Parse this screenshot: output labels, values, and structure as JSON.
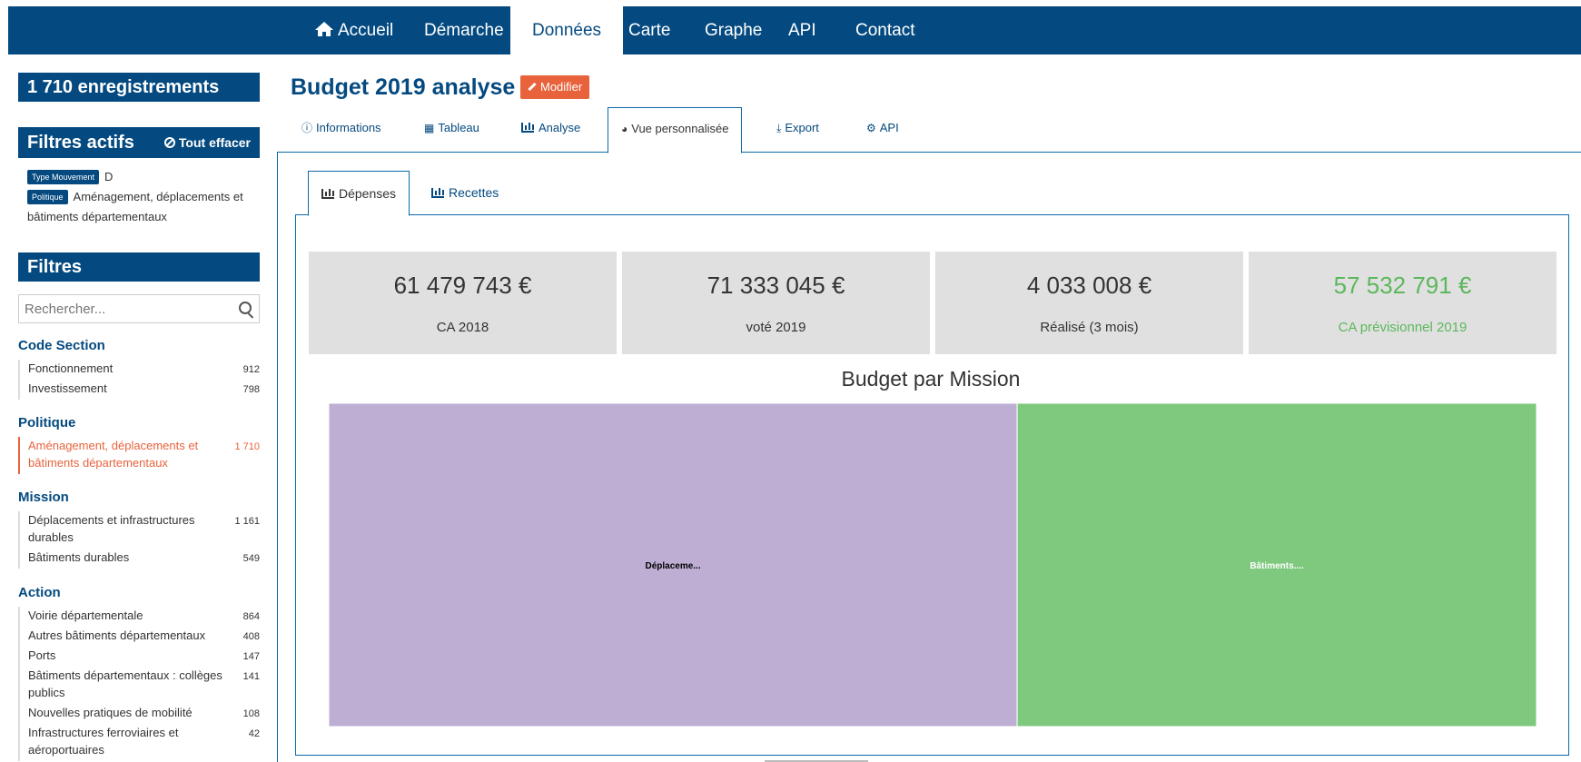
{
  "nav": {
    "items": [
      {
        "label": "Accueil",
        "icon": "home-icon"
      },
      {
        "label": "Démarche"
      },
      {
        "label": "Données",
        "active": true
      },
      {
        "label": "Carte"
      },
      {
        "label": "Graphe"
      },
      {
        "label": "API"
      },
      {
        "label": "Contact"
      }
    ]
  },
  "sidebar": {
    "count_label": "1 710 enregistrements",
    "active_filters_title": "Filtres actifs",
    "clear_all_label": "Tout effacer",
    "active_filters": [
      {
        "tag": "Type Mouvement",
        "value": "D"
      },
      {
        "tag": "Politique",
        "value": "Aménagement, déplacements et bâtiments départementaux"
      }
    ],
    "filters_title": "Filtres",
    "search_placeholder": "Rechercher...",
    "facets": [
      {
        "title": "Code Section",
        "items": [
          {
            "label": "Fonctionnement",
            "count": "912"
          },
          {
            "label": "Investissement",
            "count": "798"
          }
        ]
      },
      {
        "title": "Politique",
        "items": [
          {
            "label": "Aménagement, déplacements et bâtiments départementaux",
            "count": "1 710",
            "selected": true
          }
        ]
      },
      {
        "title": "Mission",
        "items": [
          {
            "label": "Déplacements et infrastructures durables",
            "count": "1 161"
          },
          {
            "label": "Bâtiments durables",
            "count": "549"
          }
        ]
      },
      {
        "title": "Action",
        "items": [
          {
            "label": "Voirie départementale",
            "count": "864"
          },
          {
            "label": "Autres bâtiments départementaux",
            "count": "408"
          },
          {
            "label": "Ports",
            "count": "147"
          },
          {
            "label": "Bâtiments départementaux : collèges publics",
            "count": "141"
          },
          {
            "label": "Nouvelles pratiques de mobilité",
            "count": "108"
          },
          {
            "label": "Infrastructures ferroviaires et aéroportuaires",
            "count": "42"
          }
        ]
      }
    ]
  },
  "main": {
    "title": "Budget 2019 analyse",
    "modify_label": "Modifier",
    "tabs": [
      {
        "label": "Informations",
        "icon": "info-icon"
      },
      {
        "label": "Tableau",
        "icon": "table-icon"
      },
      {
        "label": "Analyse",
        "icon": "bar-chart-icon"
      },
      {
        "label": "Vue personnalisée",
        "icon": "dashboard-icon",
        "active": true
      },
      {
        "label": "Export",
        "icon": "download-icon"
      },
      {
        "label": "API",
        "icon": "cogs-icon"
      }
    ],
    "sub_tabs": [
      {
        "label": "Dépenses",
        "active": true
      },
      {
        "label": "Recettes"
      }
    ],
    "stats": [
      {
        "value": "61 479 743 €",
        "label": "CA 2018"
      },
      {
        "value": "71 333 045 €",
        "label": "voté 2019"
      },
      {
        "value": "4 033 008 €",
        "label": "Réalisé (3 mois)"
      },
      {
        "value": "57 532 791 €",
        "label": "CA prévisionnel 2019",
        "color": "#5cb85c"
      }
    ],
    "chart_title": "Budget par Mission"
  },
  "chart_data": {
    "type": "treemap",
    "title": "Budget par Mission",
    "items": [
      {
        "label": "Déplaceme...",
        "share": 0.57,
        "color": "#beaed4",
        "label_color": "#000000"
      },
      {
        "label": "Bâtiments....",
        "share": 0.43,
        "color": "#7fc97f",
        "label_color": "#ffffff"
      }
    ]
  },
  "colors": {
    "brand": "#044a80",
    "accent": "#e8623c",
    "success": "#5cb85c"
  }
}
